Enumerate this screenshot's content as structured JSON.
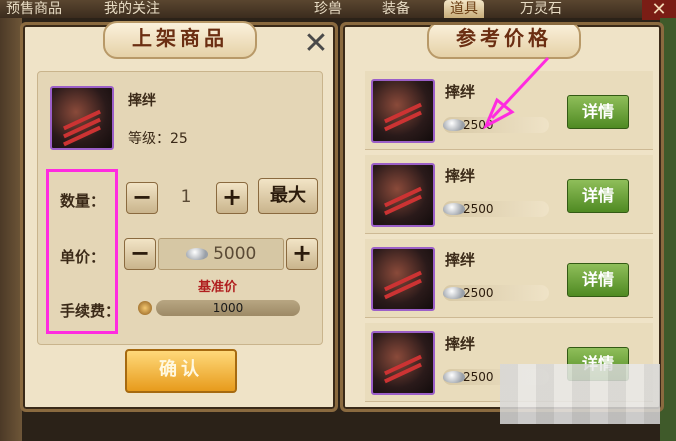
{
  "background_tabs": [
    "预售商品",
    "我的关注",
    "珍兽",
    "装备",
    "道具",
    "万灵石"
  ],
  "left_panel": {
    "title": "上架商品",
    "item": {
      "name": "摔绊",
      "level_label": "等级：",
      "level_value": "25"
    },
    "quantity": {
      "label": "数量：",
      "value": "1",
      "max_label": "最大"
    },
    "unit_price": {
      "label": "单价：",
      "value": "5000"
    },
    "reference_price_label": "基准价",
    "fee": {
      "label": "手续费：",
      "value": "1000"
    },
    "confirm_label": "确认"
  },
  "right_panel": {
    "title": "参考价格",
    "items": [
      {
        "name": "摔绊",
        "price": "2500",
        "detail": "详情"
      },
      {
        "name": "摔绊",
        "price": "2500",
        "detail": "详情"
      },
      {
        "name": "摔绊",
        "price": "2500",
        "detail": "详情"
      },
      {
        "name": "摔绊",
        "price": "2500",
        "detail": "详情"
      }
    ]
  },
  "icons": {
    "close": "close-icon",
    "silver": "silver-ingot-icon",
    "coin": "copper-coin-icon",
    "minus": "minus-icon",
    "plus": "plus-icon"
  },
  "colors": {
    "highlight": "#ff2be0",
    "detail_button": "#5f9a2c",
    "confirm_button": "#f0b033"
  }
}
